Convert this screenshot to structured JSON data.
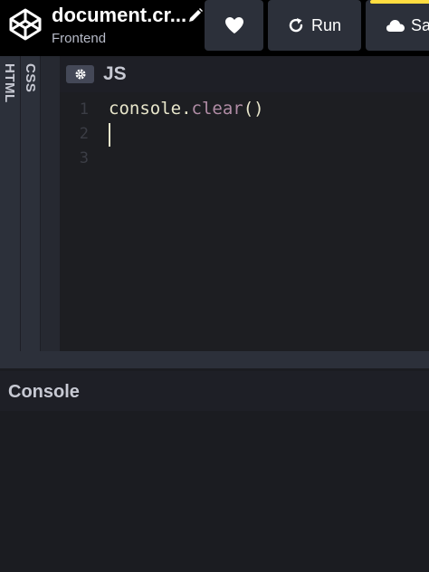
{
  "header": {
    "title": "document.cr...",
    "subtitle": "Frontend",
    "logo_icon": "codepen-logo-icon",
    "edit_icon": "pencil-icon"
  },
  "toolbar": {
    "heart_icon": "heart-icon",
    "run_label": "Run",
    "run_icon": "refresh-icon",
    "save_label": "Sa",
    "save_icon": "cloud-icon",
    "save_accent": "#ffdd40"
  },
  "tabs": {
    "html": "HTML",
    "css": "CSS"
  },
  "editor": {
    "title": "JS",
    "settings_icon": "gear-icon",
    "line_numbers": [
      "1",
      "2",
      "3"
    ],
    "code": {
      "object": "console",
      "dot": ".",
      "method": "clear",
      "parens": "()"
    }
  },
  "console": {
    "title": "Console"
  }
}
